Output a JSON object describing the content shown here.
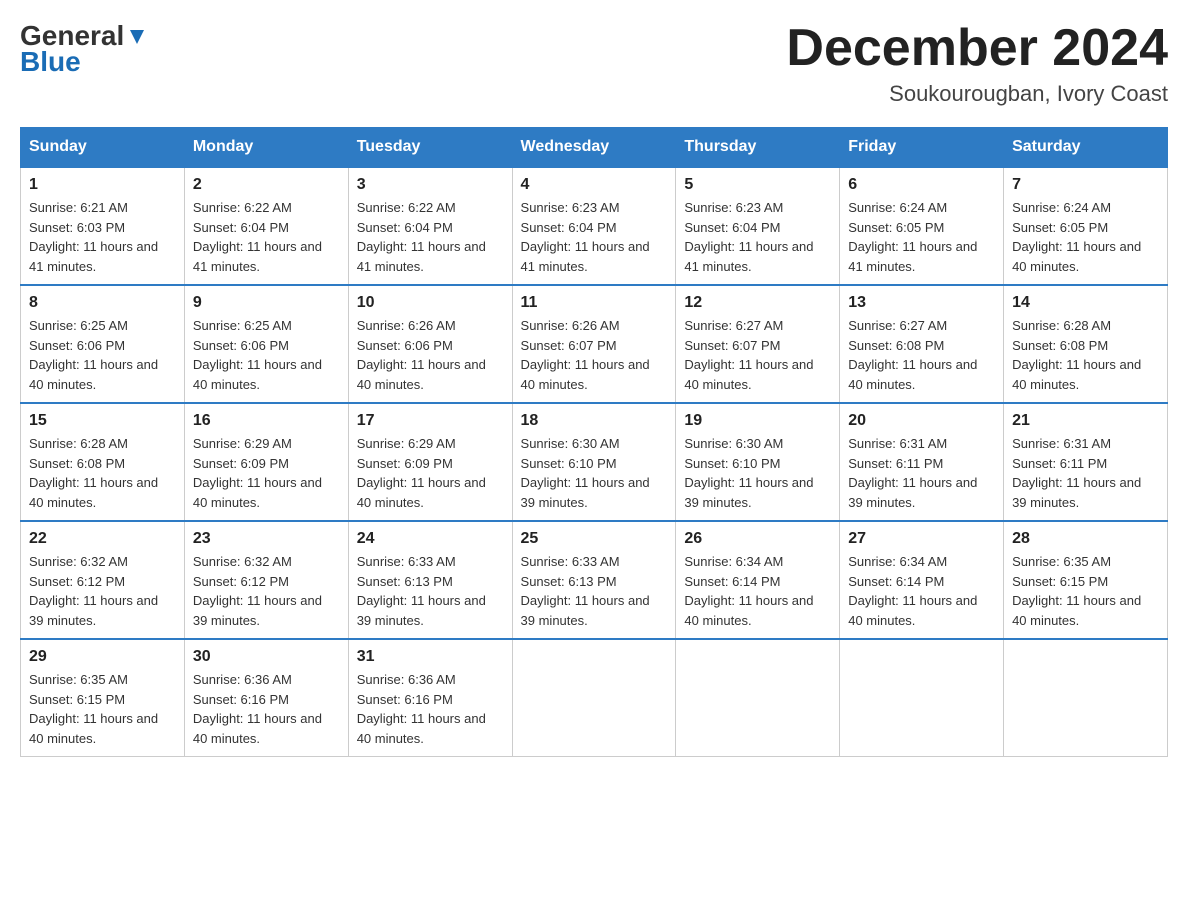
{
  "header": {
    "logo_general": "General",
    "logo_blue": "Blue",
    "month_title": "December 2024",
    "location": "Soukourougban, Ivory Coast"
  },
  "days_of_week": [
    "Sunday",
    "Monday",
    "Tuesday",
    "Wednesday",
    "Thursday",
    "Friday",
    "Saturday"
  ],
  "weeks": [
    [
      {
        "day": "1",
        "sunrise": "6:21 AM",
        "sunset": "6:03 PM",
        "daylight": "11 hours and 41 minutes."
      },
      {
        "day": "2",
        "sunrise": "6:22 AM",
        "sunset": "6:04 PM",
        "daylight": "11 hours and 41 minutes."
      },
      {
        "day": "3",
        "sunrise": "6:22 AM",
        "sunset": "6:04 PM",
        "daylight": "11 hours and 41 minutes."
      },
      {
        "day": "4",
        "sunrise": "6:23 AM",
        "sunset": "6:04 PM",
        "daylight": "11 hours and 41 minutes."
      },
      {
        "day": "5",
        "sunrise": "6:23 AM",
        "sunset": "6:04 PM",
        "daylight": "11 hours and 41 minutes."
      },
      {
        "day": "6",
        "sunrise": "6:24 AM",
        "sunset": "6:05 PM",
        "daylight": "11 hours and 41 minutes."
      },
      {
        "day": "7",
        "sunrise": "6:24 AM",
        "sunset": "6:05 PM",
        "daylight": "11 hours and 40 minutes."
      }
    ],
    [
      {
        "day": "8",
        "sunrise": "6:25 AM",
        "sunset": "6:06 PM",
        "daylight": "11 hours and 40 minutes."
      },
      {
        "day": "9",
        "sunrise": "6:25 AM",
        "sunset": "6:06 PM",
        "daylight": "11 hours and 40 minutes."
      },
      {
        "day": "10",
        "sunrise": "6:26 AM",
        "sunset": "6:06 PM",
        "daylight": "11 hours and 40 minutes."
      },
      {
        "day": "11",
        "sunrise": "6:26 AM",
        "sunset": "6:07 PM",
        "daylight": "11 hours and 40 minutes."
      },
      {
        "day": "12",
        "sunrise": "6:27 AM",
        "sunset": "6:07 PM",
        "daylight": "11 hours and 40 minutes."
      },
      {
        "day": "13",
        "sunrise": "6:27 AM",
        "sunset": "6:08 PM",
        "daylight": "11 hours and 40 minutes."
      },
      {
        "day": "14",
        "sunrise": "6:28 AM",
        "sunset": "6:08 PM",
        "daylight": "11 hours and 40 minutes."
      }
    ],
    [
      {
        "day": "15",
        "sunrise": "6:28 AM",
        "sunset": "6:08 PM",
        "daylight": "11 hours and 40 minutes."
      },
      {
        "day": "16",
        "sunrise": "6:29 AM",
        "sunset": "6:09 PM",
        "daylight": "11 hours and 40 minutes."
      },
      {
        "day": "17",
        "sunrise": "6:29 AM",
        "sunset": "6:09 PM",
        "daylight": "11 hours and 40 minutes."
      },
      {
        "day": "18",
        "sunrise": "6:30 AM",
        "sunset": "6:10 PM",
        "daylight": "11 hours and 39 minutes."
      },
      {
        "day": "19",
        "sunrise": "6:30 AM",
        "sunset": "6:10 PM",
        "daylight": "11 hours and 39 minutes."
      },
      {
        "day": "20",
        "sunrise": "6:31 AM",
        "sunset": "6:11 PM",
        "daylight": "11 hours and 39 minutes."
      },
      {
        "day": "21",
        "sunrise": "6:31 AM",
        "sunset": "6:11 PM",
        "daylight": "11 hours and 39 minutes."
      }
    ],
    [
      {
        "day": "22",
        "sunrise": "6:32 AM",
        "sunset": "6:12 PM",
        "daylight": "11 hours and 39 minutes."
      },
      {
        "day": "23",
        "sunrise": "6:32 AM",
        "sunset": "6:12 PM",
        "daylight": "11 hours and 39 minutes."
      },
      {
        "day": "24",
        "sunrise": "6:33 AM",
        "sunset": "6:13 PM",
        "daylight": "11 hours and 39 minutes."
      },
      {
        "day": "25",
        "sunrise": "6:33 AM",
        "sunset": "6:13 PM",
        "daylight": "11 hours and 39 minutes."
      },
      {
        "day": "26",
        "sunrise": "6:34 AM",
        "sunset": "6:14 PM",
        "daylight": "11 hours and 40 minutes."
      },
      {
        "day": "27",
        "sunrise": "6:34 AM",
        "sunset": "6:14 PM",
        "daylight": "11 hours and 40 minutes."
      },
      {
        "day": "28",
        "sunrise": "6:35 AM",
        "sunset": "6:15 PM",
        "daylight": "11 hours and 40 minutes."
      }
    ],
    [
      {
        "day": "29",
        "sunrise": "6:35 AM",
        "sunset": "6:15 PM",
        "daylight": "11 hours and 40 minutes."
      },
      {
        "day": "30",
        "sunrise": "6:36 AM",
        "sunset": "6:16 PM",
        "daylight": "11 hours and 40 minutes."
      },
      {
        "day": "31",
        "sunrise": "6:36 AM",
        "sunset": "6:16 PM",
        "daylight": "11 hours and 40 minutes."
      },
      null,
      null,
      null,
      null
    ]
  ]
}
